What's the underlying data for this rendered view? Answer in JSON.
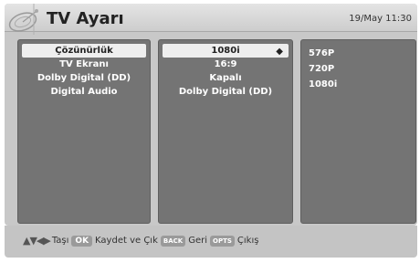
{
  "header": {
    "title": "TV Ayarı",
    "clock": "19/May 11:30",
    "logo_icon": "satellite-dish-icon"
  },
  "settings_column": {
    "items": [
      "Çözünürlük",
      "TV Ekranı",
      "Dolby Digital (DD)",
      "Digital Audio"
    ],
    "selected_index": 0
  },
  "values_column": {
    "items": [
      "1080i",
      "16:9",
      "Kapalı",
      "Dolby Digital (DD)"
    ],
    "selected_index": 0,
    "selected_marker_icon": "diamond-icon"
  },
  "options_column": {
    "items": [
      "576P",
      "720P",
      "1080i"
    ]
  },
  "footer": {
    "move_icon": "arrow-keys-icon",
    "move_label": "Taşı",
    "ok_key": "OK",
    "ok_label": "Kaydet ve Çık",
    "back_key": "BACK",
    "back_label": "Geri",
    "opts_key": "OPTS",
    "opts_label": "Çıkış"
  },
  "colors": {
    "panel": "#747474",
    "background": "#c8c8c8",
    "selected": "#eeeeee"
  }
}
